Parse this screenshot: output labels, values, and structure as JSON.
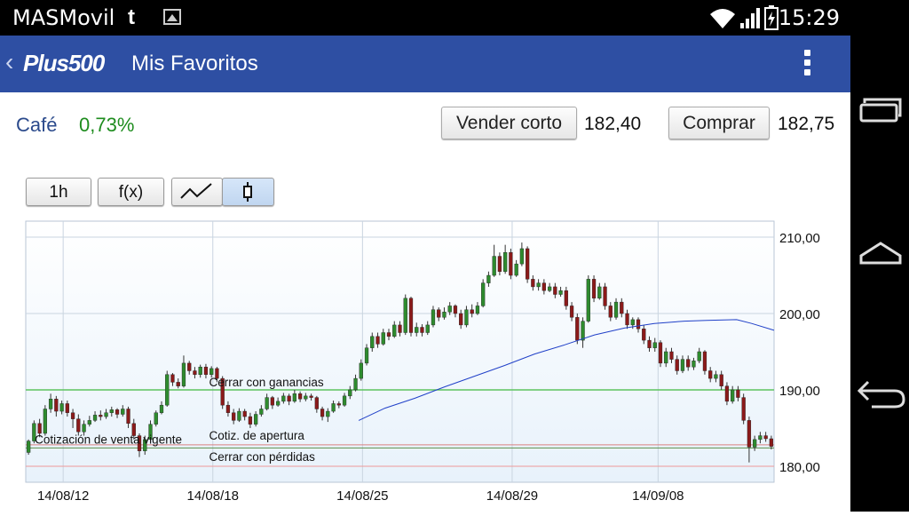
{
  "status_bar": {
    "carrier": "MASMovil",
    "carrier_icon": "t-mobile-logo-icon",
    "notification_icon": "image-icon",
    "time": "15:29",
    "icons": [
      "wifi-icon",
      "signal-icon",
      "battery-charging-icon"
    ]
  },
  "app_bar": {
    "logo": "Plus500",
    "title": "Mis Favoritos",
    "back_icon": "chevron-left-icon",
    "menu_icon": "overflow-menu-icon"
  },
  "quote": {
    "instrument": "Café",
    "change": "0,73%",
    "sell_label": "Vender corto",
    "sell_price": "182,40",
    "buy_label": "Comprar",
    "buy_price": "182,75"
  },
  "toolbar": {
    "timeframe": "1h",
    "indicators": "f(x)",
    "line_chart_icon": "line-chart-icon",
    "candle_chart_icon": "candlestick-icon",
    "selected": "candlestick"
  },
  "nav_bar": {
    "buttons": [
      "recent-apps-icon",
      "home-icon",
      "back-icon"
    ]
  },
  "chart_data": {
    "type": "candlestick",
    "x_labels": [
      "14/08/12",
      "14/08/18",
      "14/08/25",
      "14/08/29",
      "14/09/08"
    ],
    "y_ticks": [
      "210,00",
      "200,00",
      "190,00",
      "180,00"
    ],
    "ylim": [
      177.9,
      212.1
    ],
    "grid": true,
    "colors": {
      "up": "#2e8b2e",
      "down": "#8b1a1a",
      "moving_average": "#2040c8",
      "take_profit": "#5ec45e",
      "stop_loss": "#ef9a9a",
      "open_price": "#d98080",
      "current_sell": "#5b8f4a"
    },
    "lines": [
      {
        "label": "Cerrar con ganancias",
        "value": 190.0
      },
      {
        "label": "Cotización de venta vigente",
        "value": 182.4
      },
      {
        "label": "Cotiz. de apertura",
        "value": 182.8
      },
      {
        "label": "Cerrar con pérdidas",
        "value": 180.0
      }
    ],
    "candles": [
      [
        181.8,
        183.3,
        181.5,
        183.5
      ],
      [
        183.3,
        185.6,
        183.0,
        186.0
      ],
      [
        185.6,
        184.3,
        183.8,
        186.2
      ],
      [
        184.3,
        187.5,
        184.0,
        188.0
      ],
      [
        187.5,
        188.8,
        187.0,
        189.5
      ],
      [
        188.8,
        187.2,
        186.5,
        189.2
      ],
      [
        187.2,
        188.2,
        186.8,
        188.6
      ],
      [
        188.2,
        187.0,
        186.5,
        188.6
      ],
      [
        187.0,
        186.2,
        185.0,
        187.5
      ],
      [
        186.2,
        184.5,
        184.0,
        186.8
      ],
      [
        184.5,
        185.5,
        184.0,
        186.0
      ],
      [
        185.5,
        186.0,
        185.2,
        186.6
      ],
      [
        186.0,
        186.7,
        185.8,
        187.2
      ],
      [
        186.7,
        186.5,
        186.0,
        187.3
      ],
      [
        186.5,
        187.0,
        186.2,
        187.5
      ],
      [
        187.0,
        187.4,
        186.5,
        187.8
      ],
      [
        187.4,
        186.8,
        186.3,
        187.6
      ],
      [
        186.8,
        187.5,
        186.5,
        188.0
      ],
      [
        187.5,
        185.6,
        185.0,
        187.8
      ],
      [
        185.6,
        184.0,
        183.5,
        186.2
      ],
      [
        184.0,
        182.0,
        181.2,
        184.3
      ],
      [
        182.0,
        183.5,
        181.5,
        184.0
      ],
      [
        183.5,
        185.5,
        183.2,
        186.0
      ],
      [
        185.5,
        187.0,
        185.2,
        187.3
      ],
      [
        187.0,
        188.0,
        186.8,
        188.5
      ],
      [
        188.0,
        192.0,
        187.8,
        192.5
      ],
      [
        192.0,
        191.0,
        190.5,
        192.2
      ],
      [
        191.0,
        190.5,
        190.2,
        191.5
      ],
      [
        190.5,
        193.5,
        190.3,
        194.5
      ],
      [
        193.5,
        192.5,
        192.0,
        193.8
      ],
      [
        192.5,
        192.0,
        191.5,
        193.0
      ],
      [
        192.0,
        193.0,
        191.6,
        193.3
      ],
      [
        193.0,
        192.0,
        191.5,
        193.4
      ],
      [
        192.0,
        192.8,
        191.6,
        193.1
      ],
      [
        192.8,
        191.5,
        191.0,
        193.0
      ],
      [
        191.5,
        188.0,
        187.5,
        191.8
      ],
      [
        188.0,
        187.0,
        186.5,
        188.5
      ],
      [
        187.0,
        186.0,
        185.5,
        187.5
      ],
      [
        186.0,
        187.2,
        185.8,
        187.6
      ],
      [
        187.2,
        186.5,
        186.0,
        187.5
      ],
      [
        186.5,
        185.5,
        185.0,
        187.0
      ],
      [
        185.5,
        186.8,
        185.2,
        187.2
      ],
      [
        186.8,
        187.5,
        186.5,
        188.0
      ],
      [
        187.5,
        189.0,
        187.3,
        189.5
      ],
      [
        189.0,
        188.0,
        187.5,
        189.2
      ],
      [
        188.0,
        188.5,
        187.8,
        189.0
      ],
      [
        188.5,
        189.2,
        188.2,
        189.6
      ],
      [
        189.2,
        188.5,
        188.0,
        189.5
      ],
      [
        188.5,
        189.5,
        188.3,
        190.0
      ],
      [
        189.5,
        188.8,
        188.4,
        189.8
      ],
      [
        188.8,
        189.2,
        188.5,
        189.6
      ],
      [
        189.2,
        189.0,
        188.6,
        189.5
      ],
      [
        189.0,
        187.5,
        187.0,
        189.2
      ],
      [
        187.5,
        186.5,
        186.0,
        187.8
      ],
      [
        186.5,
        187.2,
        185.8,
        187.6
      ],
      [
        187.2,
        188.2,
        187.0,
        188.6
      ],
      [
        188.2,
        188.0,
        187.6,
        188.5
      ],
      [
        188.0,
        189.2,
        187.8,
        189.6
      ],
      [
        189.2,
        190.0,
        188.8,
        190.5
      ],
      [
        190.0,
        191.5,
        189.8,
        192.0
      ],
      [
        191.5,
        193.5,
        191.2,
        194.0
      ],
      [
        193.5,
        195.5,
        193.2,
        196.0
      ],
      [
        195.5,
        197.0,
        195.0,
        197.5
      ],
      [
        197.0,
        196.0,
        195.5,
        197.5
      ],
      [
        196.0,
        197.5,
        195.8,
        198.0
      ],
      [
        197.5,
        197.0,
        196.5,
        198.0
      ],
      [
        197.0,
        198.5,
        196.8,
        199.0
      ],
      [
        198.5,
        197.5,
        197.0,
        199.0
      ],
      [
        197.5,
        202.0,
        197.2,
        202.5
      ],
      [
        202.0,
        197.5,
        197.0,
        202.2
      ],
      [
        197.5,
        198.2,
        197.0,
        198.8
      ],
      [
        198.2,
        197.5,
        197.0,
        198.6
      ],
      [
        197.5,
        198.5,
        197.2,
        199.0
      ],
      [
        198.5,
        200.5,
        198.2,
        201.0
      ],
      [
        200.5,
        199.5,
        199.0,
        200.8
      ],
      [
        199.5,
        200.2,
        199.2,
        200.8
      ],
      [
        200.2,
        201.0,
        199.8,
        201.5
      ],
      [
        201.0,
        200.0,
        199.5,
        201.2
      ],
      [
        200.0,
        198.5,
        198.0,
        200.5
      ],
      [
        198.5,
        200.5,
        198.2,
        201.0
      ],
      [
        200.5,
        200.0,
        199.5,
        201.2
      ],
      [
        200.0,
        201.0,
        199.8,
        201.5
      ],
      [
        201.0,
        204.0,
        200.8,
        204.5
      ],
      [
        204.0,
        205.0,
        203.5,
        205.5
      ],
      [
        205.0,
        207.5,
        204.8,
        209.0
      ],
      [
        207.5,
        205.5,
        205.0,
        208.0
      ],
      [
        205.5,
        208.0,
        205.2,
        209.0
      ],
      [
        208.0,
        205.0,
        204.5,
        208.5
      ],
      [
        205.0,
        206.5,
        204.8,
        207.0
      ],
      [
        206.5,
        208.5,
        206.2,
        209.3
      ],
      [
        208.5,
        204.5,
        204.0,
        208.8
      ],
      [
        204.5,
        203.5,
        203.0,
        205.0
      ],
      [
        203.5,
        204.0,
        203.0,
        204.5
      ],
      [
        204.0,
        203.0,
        202.5,
        204.5
      ],
      [
        203.0,
        203.5,
        202.8,
        204.0
      ],
      [
        203.5,
        202.5,
        202.0,
        204.0
      ],
      [
        202.5,
        203.0,
        202.2,
        203.5
      ],
      [
        203.0,
        201.0,
        200.5,
        203.5
      ],
      [
        201.0,
        199.5,
        199.0,
        201.5
      ],
      [
        199.5,
        196.5,
        196.0,
        200.0
      ],
      [
        196.5,
        199.0,
        195.5,
        199.5
      ],
      [
        199.0,
        204.5,
        198.8,
        205.0
      ],
      [
        204.5,
        202.0,
        201.5,
        205.0
      ],
      [
        202.0,
        203.5,
        201.8,
        204.0
      ],
      [
        203.5,
        201.0,
        200.5,
        204.0
      ],
      [
        201.0,
        199.5,
        199.0,
        201.5
      ],
      [
        199.5,
        201.5,
        199.2,
        202.0
      ],
      [
        201.5,
        200.0,
        199.5,
        202.0
      ],
      [
        200.0,
        198.5,
        198.0,
        200.5
      ],
      [
        198.5,
        199.2,
        198.0,
        199.5
      ],
      [
        199.2,
        198.0,
        197.5,
        199.5
      ],
      [
        198.0,
        196.5,
        196.0,
        198.5
      ],
      [
        196.5,
        195.5,
        195.0,
        197.0
      ],
      [
        195.5,
        196.2,
        195.0,
        196.8
      ],
      [
        196.2,
        193.5,
        193.0,
        196.5
      ],
      [
        193.5,
        195.0,
        193.0,
        195.5
      ],
      [
        195.0,
        194.0,
        193.5,
        195.5
      ],
      [
        194.0,
        192.5,
        192.0,
        194.5
      ],
      [
        192.5,
        194.0,
        192.2,
        194.5
      ],
      [
        194.0,
        193.0,
        192.5,
        194.5
      ],
      [
        193.0,
        193.8,
        192.6,
        194.2
      ],
      [
        193.8,
        195.0,
        193.5,
        195.5
      ],
      [
        195.0,
        192.5,
        192.0,
        195.2
      ],
      [
        192.5,
        191.5,
        191.0,
        193.0
      ],
      [
        191.5,
        192.0,
        191.0,
        192.5
      ],
      [
        192.0,
        190.5,
        190.0,
        192.5
      ],
      [
        190.5,
        188.5,
        188.0,
        191.0
      ],
      [
        188.5,
        190.0,
        188.2,
        190.5
      ],
      [
        190.0,
        189.0,
        188.5,
        190.5
      ],
      [
        189.0,
        186.0,
        185.5,
        189.5
      ],
      [
        186.0,
        182.5,
        180.5,
        186.5
      ],
      [
        182.5,
        183.5,
        182.0,
        184.0
      ],
      [
        183.5,
        184.0,
        183.0,
        184.5
      ],
      [
        184.0,
        183.6,
        183.2,
        184.5
      ],
      [
        183.6,
        182.6,
        182.2,
        184.0
      ]
    ],
    "moving_average": [
      [
        0.445,
        186.0
      ],
      [
        0.48,
        187.6
      ],
      [
        0.52,
        188.9
      ],
      [
        0.56,
        190.4
      ],
      [
        0.6,
        191.8
      ],
      [
        0.64,
        193.2
      ],
      [
        0.68,
        194.7
      ],
      [
        0.72,
        195.9
      ],
      [
        0.76,
        197.2
      ],
      [
        0.8,
        198.1
      ],
      [
        0.84,
        198.7
      ],
      [
        0.88,
        199.0
      ],
      [
        0.91,
        199.1
      ],
      [
        0.95,
        199.2
      ],
      [
        0.97,
        198.7
      ],
      [
        1.0,
        197.8
      ]
    ]
  }
}
